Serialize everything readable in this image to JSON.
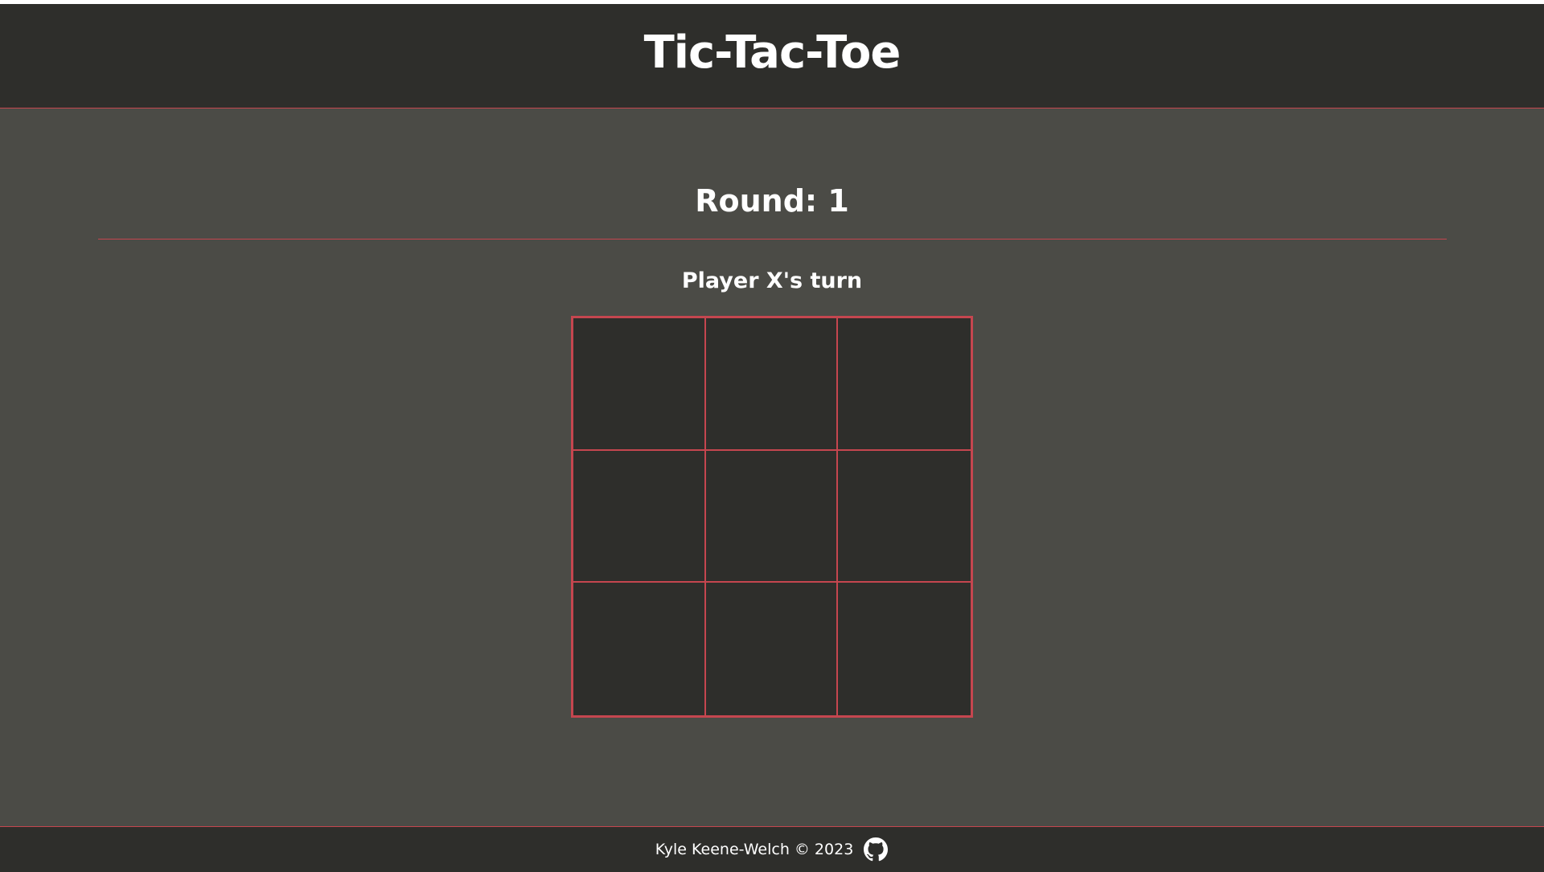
{
  "header": {
    "title": "Tic-Tac-Toe"
  },
  "game": {
    "round_label": "Round: 1",
    "turn_label": "Player X's turn",
    "board": [
      [
        "",
        "",
        ""
      ],
      [
        "",
        "",
        ""
      ],
      [
        "",
        "",
        ""
      ]
    ]
  },
  "footer": {
    "credit": "Kyle Keene-Welch © 2023",
    "link_icon": "github-icon"
  },
  "colors": {
    "accent": "#c5464f",
    "header_bg": "#2e2e2b",
    "page_bg": "#4b4b46",
    "text": "#ffffff"
  }
}
